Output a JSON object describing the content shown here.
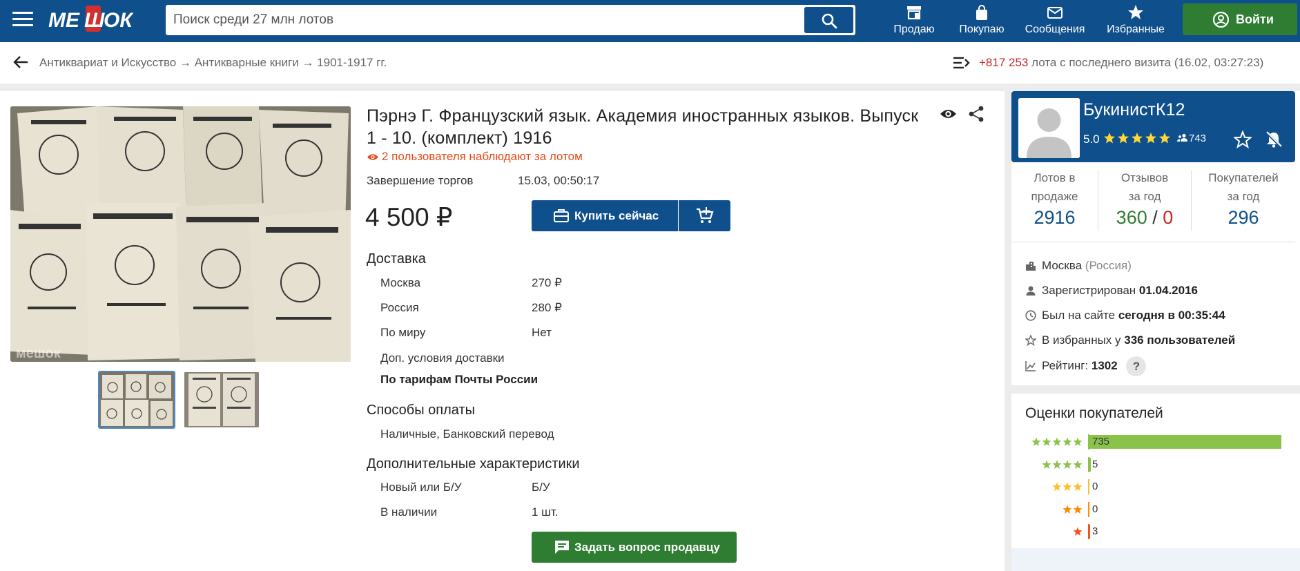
{
  "header": {
    "logo_text": "МЕШОК",
    "search": {
      "placeholder": "Поиск среди 27 млн лотов"
    },
    "nav": [
      {
        "label": "Продаю",
        "icon": "store-icon"
      },
      {
        "label": "Покупаю",
        "icon": "shopping-bag-icon"
      },
      {
        "label": "Сообщения",
        "icon": "envelope-icon"
      },
      {
        "label": "Избранные",
        "icon": "star-icon"
      }
    ],
    "login_label": "Войти"
  },
  "breadcrumb": {
    "items": [
      "Антиквариат и Искусство",
      "Антикварные книги",
      "1901-1917 гг."
    ],
    "separator": "→",
    "new_lots_count": "+817 253",
    "new_lots_text": "лота с последнего визита (16.02, 03:27:23)"
  },
  "lot": {
    "title": "Пэрнэ Г. Французский язык. Академия иностранных языков. Выпуск 1 - 10. (комплект) 1916",
    "watchers": "2 пользователя наблюдают за лотом",
    "end_label": "Завершение торгов",
    "end_value": "15.03, 00:50:17",
    "price": "4 500 ₽",
    "buy_label": "Купить сейчас",
    "delivery": {
      "heading": "Доставка",
      "rows": [
        {
          "label": "Москва",
          "value": "270 ₽"
        },
        {
          "label": "Россия",
          "value": "280 ₽"
        },
        {
          "label": "По миру",
          "value": "Нет"
        }
      ],
      "extra_label": "Доп. условия доставки",
      "extra_value": "По тарифам Почты России"
    },
    "payment": {
      "heading": "Способы оплаты",
      "value": "Наличные, Банковский перевод"
    },
    "characteristics": {
      "heading": "Дополнительные характеристики",
      "rows": [
        {
          "label": "Новый или Б/У",
          "value": "Б/У"
        },
        {
          "label": "В наличии",
          "value": "1 шт."
        }
      ]
    },
    "ask_label": "Задать вопрос продавцу",
    "image_watermark": "мешок"
  },
  "seller": {
    "name": "БукинистК12",
    "rating": "5.0",
    "reviews_count": "743",
    "stats": [
      {
        "label_1": "Лотов в",
        "label_2": "продаже",
        "value": "2916"
      },
      {
        "label_1": "Отзывов",
        "label_2": "за год",
        "value_pos": "360",
        "value_sep": "/",
        "value_neg": "0"
      },
      {
        "label_1": "Покупателей",
        "label_2": "за год",
        "value": "296"
      }
    ],
    "city": "Москва",
    "country": "(Россия)",
    "registered_label": "Зарегистрирован",
    "registered_date": "01.04.2016",
    "seen_label": "Был на сайте",
    "seen_value": "сегодня в 00:35:44",
    "fav_label": "В избранных у",
    "fav_value": "336 пользователей",
    "rating_label": "Рейтинг:",
    "rating_value": "1302",
    "help_mark": "?"
  },
  "buyer_ratings": {
    "heading": "Оценки покупателей",
    "rows": [
      {
        "stars": 5,
        "count": "735",
        "value": 735,
        "color": "#8bc34a"
      },
      {
        "stars": 4,
        "count": "5",
        "value": 5,
        "color": "#8bc34a"
      },
      {
        "stars": 3,
        "count": "0",
        "value": 0,
        "color": "#fbc02d"
      },
      {
        "stars": 2,
        "count": "0",
        "value": 0,
        "color": "#fb8c00"
      },
      {
        "stars": 1,
        "count": "3",
        "value": 3,
        "color": "#f4511e"
      }
    ]
  },
  "colors": {
    "brand": "#0f4f8c",
    "green": "#2e7d32",
    "positive": "#2e7d32",
    "negative": "#c62828",
    "link_value": "#0f4f8c"
  }
}
